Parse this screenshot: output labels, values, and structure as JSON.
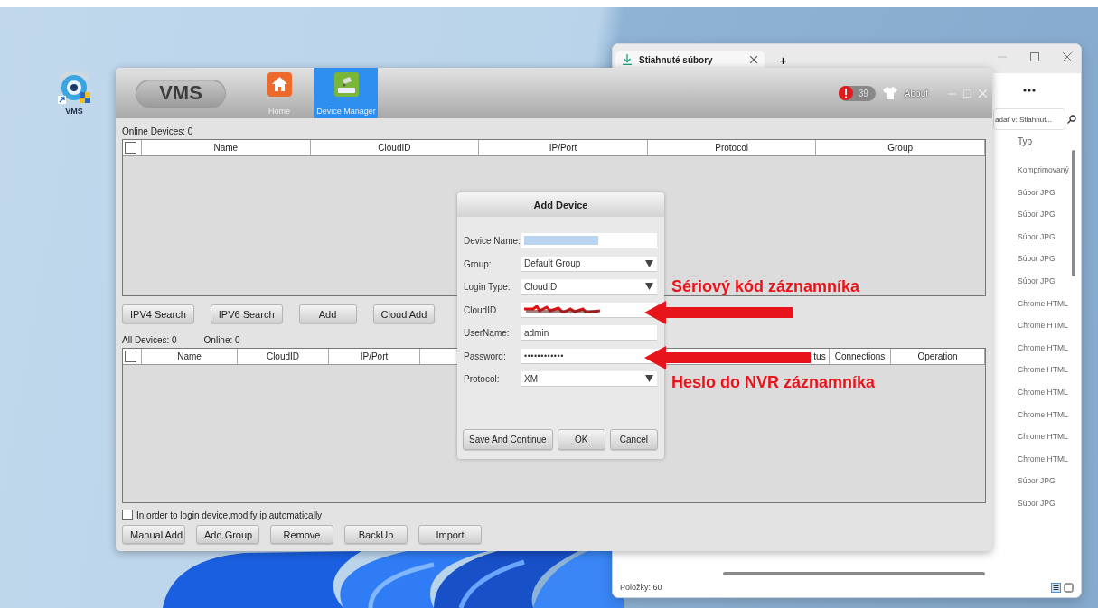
{
  "desktop": {
    "icons": [
      {
        "label": "VMS"
      }
    ]
  },
  "browser_window": {
    "tabs": [
      {
        "label": "Stiahnuté súbory",
        "selected": true
      }
    ],
    "new_tab": "+",
    "search": {
      "placeholder": "adať v: Stiahnut..."
    },
    "column_header": "Typ",
    "rows": [
      "Komprimovaný",
      "Súbor JPG",
      "Súbor JPG",
      "Súbor JPG",
      "Súbor JPG",
      "Súbor JPG",
      "Chrome HTML",
      "Chrome HTML",
      "Chrome HTML",
      "Chrome HTML",
      "Chrome HTML",
      "Chrome HTML",
      "Chrome HTML",
      "Chrome HTML",
      "Súbor JPG",
      "Súbor JPG"
    ],
    "status_bar": "Položky: 60"
  },
  "vms_window": {
    "logo": "VMS",
    "nav": [
      {
        "label": "Home",
        "kind": "home",
        "selected": false
      },
      {
        "label": "Device Manager",
        "kind": "device",
        "selected": true
      }
    ],
    "alert_count": "39",
    "about": "About",
    "online_devices": "Online Devices: 0",
    "online_table": {
      "checked": false,
      "columns": [
        "Name",
        "CloudID",
        "IP/Port",
        "Protocol",
        "Group"
      ]
    },
    "search_buttons": [
      "IPV4 Search",
      "IPV6 Search",
      "Add",
      "Cloud Add"
    ],
    "all_devices": "All Devices: 0",
    "online": "Online: 0",
    "device_table": {
      "checked": false,
      "columns": [
        "Name",
        "CloudID",
        "IP/Port",
        "tus",
        "Connections",
        "Operation"
      ]
    },
    "auto_ip": {
      "label": "In order to login device,modify ip automatically",
      "checked": false
    },
    "buttons": [
      "Manual Add",
      "Add Group",
      "Remove",
      "BackUp",
      "Import"
    ]
  },
  "dialog": {
    "title": "Add Device",
    "fields": [
      {
        "label": "Device Name:",
        "kind": "highlighted"
      },
      {
        "label": "Group:",
        "kind": "select",
        "value": "Default Group"
      },
      {
        "label": "Login Type:",
        "kind": "select",
        "value": "CloudID"
      },
      {
        "label": "CloudID",
        "kind": "redacted"
      },
      {
        "label": "UserName:",
        "kind": "text",
        "value": "admin"
      },
      {
        "label": "Password:",
        "kind": "password",
        "value": "••••••••••••"
      },
      {
        "label": "Protocol:",
        "kind": "select",
        "value": "XM"
      }
    ],
    "buttons": [
      "Save And Continue",
      "OK",
      "Cancel"
    ]
  },
  "annotations": [
    {
      "text": "Sériový kód záznamníka"
    },
    {
      "text": "Heslo do NVR záznamníka"
    }
  ]
}
